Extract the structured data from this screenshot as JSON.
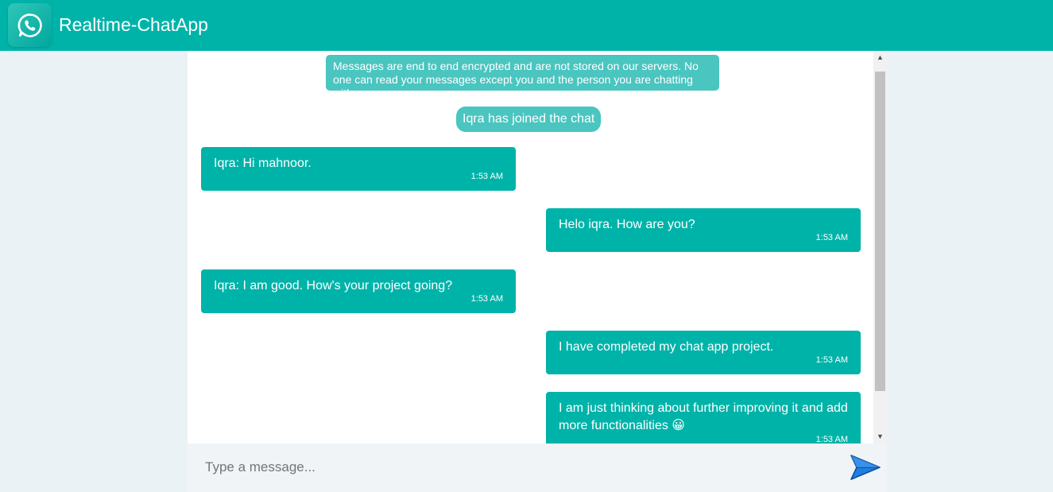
{
  "header": {
    "title": "Realtime-ChatApp",
    "color": "#00b3a9"
  },
  "chat": {
    "notice": "Messages are end to end encrypted and are not stored on our servers. No one can read your messages except you and the person you are chatting with.",
    "joined": "Iqra has joined the chat",
    "messages": [
      {
        "side": "incoming",
        "text": "Iqra: Hi mahnoor.",
        "time": "1:53 AM"
      },
      {
        "side": "outgoing",
        "text": "Helo iqra. How are you?",
        "time": "1:53 AM"
      },
      {
        "side": "incoming",
        "text": "Iqra: I am good. How's your project going?",
        "time": "1:53 AM"
      },
      {
        "side": "outgoing",
        "text": "I have completed my chat app project.",
        "time": "1:53 AM"
      },
      {
        "side": "outgoing",
        "text": "I am just thinking about further improving it and add more functionalities 😀",
        "time": "1:53 AM"
      }
    ]
  },
  "composer": {
    "placeholder": "Type a message...",
    "value": ""
  },
  "icons": {
    "logo": "whatsapp-icon",
    "send": "send-arrow-icon"
  }
}
